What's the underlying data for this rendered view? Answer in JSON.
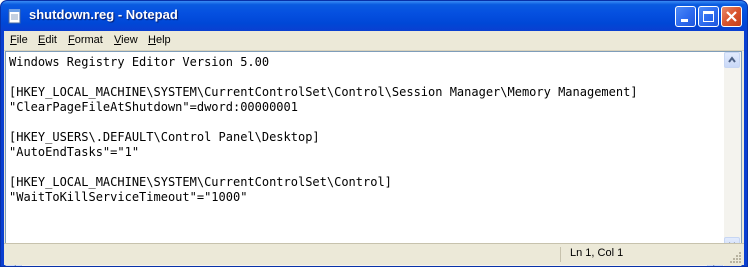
{
  "window": {
    "title": "shutdown.reg - Notepad",
    "icon": "notepad-icon",
    "controls": [
      "minimize-icon",
      "maximize-icon",
      "close-icon"
    ],
    "titlebar_color": "#0a5be0",
    "close_color": "#d9542e"
  },
  "menu": {
    "items": [
      {
        "label": "File"
      },
      {
        "label": "Edit"
      },
      {
        "label": "Format"
      },
      {
        "label": "View"
      },
      {
        "label": "Help"
      }
    ]
  },
  "document": {
    "lines": [
      "Windows Registry Editor Version 5.00",
      "",
      "[HKEY_LOCAL_MACHINE\\SYSTEM\\CurrentControlSet\\Control\\Session Manager\\Memory Management]",
      "\"ClearPageFileAtShutdown\"=dword:00000001",
      "",
      "[HKEY_USERS\\.DEFAULT\\Control Panel\\Desktop]",
      "\"AutoEndTasks\"=\"1\"",
      "",
      "[HKEY_LOCAL_MACHINE\\SYSTEM\\CurrentControlSet\\Control]",
      "\"WaitToKillServiceTimeout\"=\"1000\""
    ]
  },
  "statusbar": {
    "position": "Ln 1, Col 1"
  }
}
